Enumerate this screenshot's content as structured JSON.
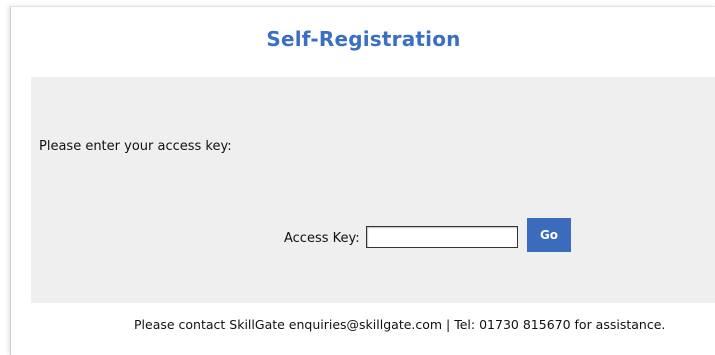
{
  "page": {
    "title": "Self-Registration"
  },
  "form": {
    "prompt": "Please enter your access key:",
    "access_key_label": "Access Key:",
    "access_key_value": "",
    "go_label": "Go"
  },
  "footer": {
    "text": "Please contact SkillGate enquiries@skillgate.com | Tel: 01730 815670 for assistance."
  },
  "colors": {
    "title": "#3b6fc4",
    "button": "#3a6bbd",
    "panel": "#efefef"
  }
}
